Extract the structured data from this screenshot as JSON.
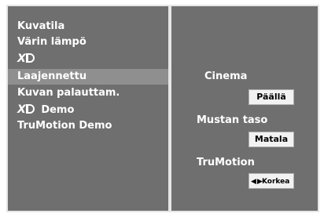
{
  "menu": {
    "items": [
      {
        "label": "Kuvatila"
      },
      {
        "label": "Värin lämpö"
      },
      {
        "label": "XD",
        "logo": true
      },
      {
        "label": "Laajennettu",
        "selected": true
      },
      {
        "label": "Kuvan palauttam."
      },
      {
        "label": "XD Demo",
        "logo_prefix": "XD",
        "text": "Demo"
      },
      {
        "label": "TruMotion Demo"
      }
    ]
  },
  "settings": {
    "cinema": {
      "label": "Cinema",
      "value": "Päällä"
    },
    "black_level": {
      "label": "Mustan taso",
      "value": "Matala"
    },
    "trumotion": {
      "label": "TruMotion",
      "arrows": "◀ ▶",
      "value": "Korkea"
    }
  },
  "colors": {
    "panel_bg": "#6f6f6f",
    "selected_bg": "#8f8f8f",
    "text": "#ffffff",
    "value_box_bg": "#f2f2f2"
  }
}
